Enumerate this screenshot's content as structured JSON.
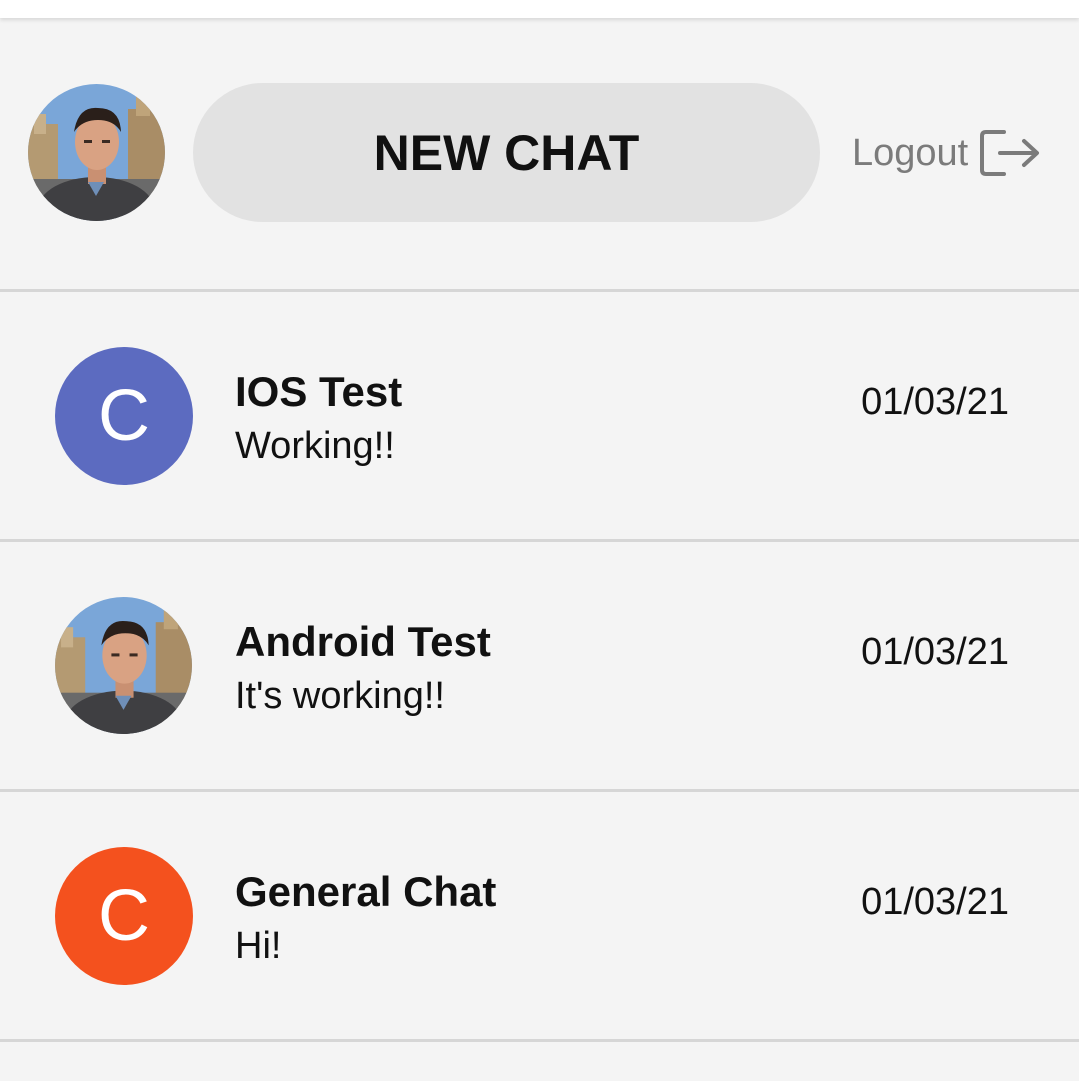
{
  "header": {
    "new_chat_label": "NEW CHAT",
    "logout_label": "Logout",
    "logout_icon": "logout-icon",
    "user_avatar": "profile-photo"
  },
  "chats": [
    {
      "title": "IOS Test",
      "last_message": "Working!!",
      "date": "01/03/21",
      "avatar_type": "letter",
      "avatar_letter": "C",
      "avatar_color": "#5c6bc0"
    },
    {
      "title": "Android Test",
      "last_message": "It's working!!",
      "date": "01/03/21",
      "avatar_type": "photo"
    },
    {
      "title": "General Chat",
      "last_message": "Hi!",
      "date": "01/03/21",
      "avatar_type": "letter",
      "avatar_letter": "C",
      "avatar_color": "#f4511e"
    }
  ],
  "colors": {
    "background": "#f4f4f4",
    "button_background": "#e2e2e2",
    "divider": "#d6d6d6",
    "muted_text": "#7b7b7b"
  }
}
